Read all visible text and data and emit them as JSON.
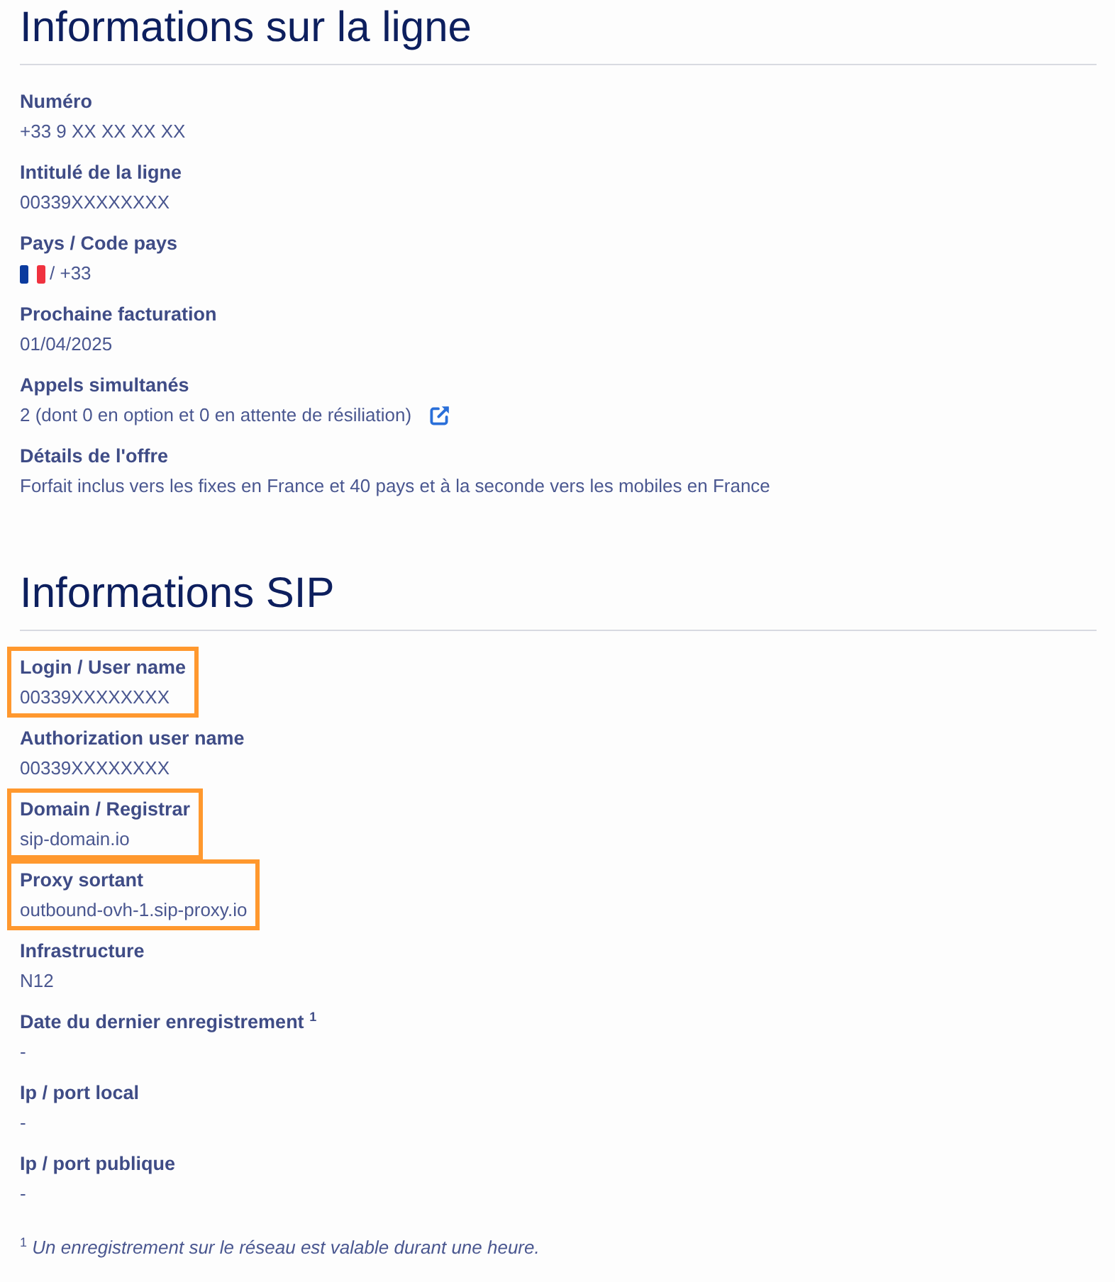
{
  "sections": [
    {
      "title": "Informations sur la ligne",
      "fields": [
        {
          "label": "Numéro",
          "value": "+33 9 XX XX XX XX",
          "kind": "text",
          "highlighted": false
        },
        {
          "label": "Intitulé de la ligne",
          "value": "00339XXXXXXXX",
          "kind": "text",
          "highlighted": false
        },
        {
          "label": "Pays / Code pays",
          "value": "/ +33",
          "kind": "flag",
          "highlighted": false
        },
        {
          "label": "Prochaine facturation",
          "value": "01/04/2025",
          "kind": "text",
          "highlighted": false
        },
        {
          "label": "Appels simultanés",
          "value": "2 (dont 0 en option et 0 en attente de résiliation)",
          "kind": "external_link",
          "highlighted": false
        },
        {
          "label": "Détails de l'offre",
          "value": "Forfait inclus vers les fixes en France et 40 pays et à la seconde vers les mobiles en France",
          "kind": "text",
          "highlighted": false
        }
      ]
    },
    {
      "title": "Informations SIP",
      "fields": [
        {
          "label": "Login / User name",
          "value": "00339XXXXXXXX",
          "kind": "text",
          "highlighted": true
        },
        {
          "label": "Authorization user name",
          "value": "00339XXXXXXXX",
          "kind": "text",
          "highlighted": false
        },
        {
          "label": "Domain / Registrar",
          "value": "sip-domain.io",
          "kind": "text",
          "highlighted": true
        },
        {
          "label": "Proxy sortant",
          "value": "outbound-ovh-1.sip-proxy.io",
          "kind": "text",
          "highlighted": true
        },
        {
          "label": "Infrastructure",
          "value": "N12",
          "kind": "text",
          "highlighted": false
        },
        {
          "label": "Date du dernier enregistrement $^{1}$",
          "value": "-",
          "kind": "text",
          "highlighted": false
        },
        {
          "label": "Ip / port local",
          "value": "-",
          "kind": "text",
          "highlighted": false
        },
        {
          "label": "Ip / port publique",
          "value": "-",
          "kind": "text",
          "highlighted": false
        }
      ]
    }
  ],
  "footnote": "$^{1}$ *Un enregistrement sur le réseau est valable durant une heure.*"
}
